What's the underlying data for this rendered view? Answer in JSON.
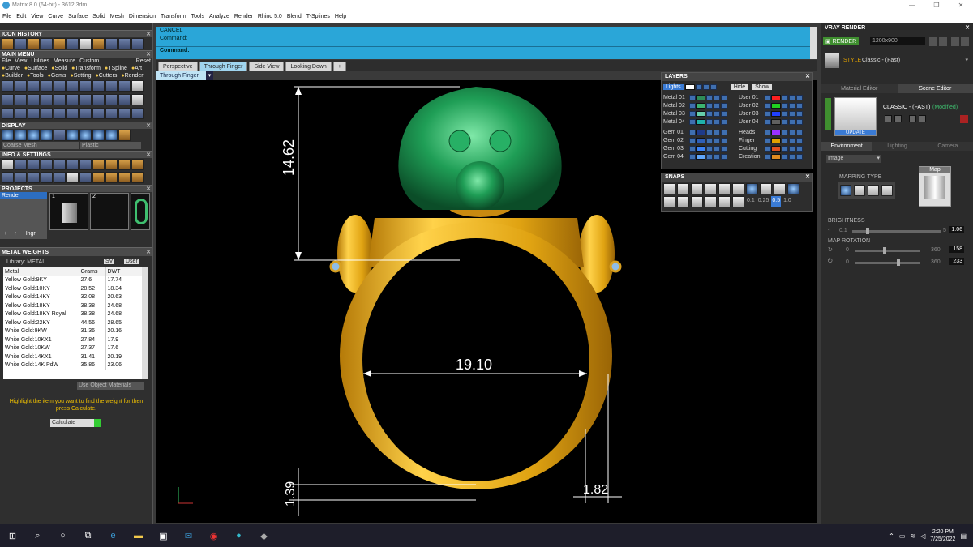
{
  "window": {
    "title": "Matrix 8.0 (64-bit) - 3612.3dm"
  },
  "menu": [
    "File",
    "Edit",
    "View",
    "Curve",
    "Surface",
    "Solid",
    "Mesh",
    "Dimension",
    "Transform",
    "Tools",
    "Analyze",
    "Render",
    "Rhino 5.0",
    "Blend",
    "T-Splines",
    "Help"
  ],
  "left": {
    "icon_history": "ICON HISTORY",
    "main_menu": "MAIN MENU",
    "main_menu_row1": [
      "File",
      "View",
      "Utilities",
      "Measure",
      "Custom",
      "Reset"
    ],
    "main_menu_row2": [
      "Curve",
      "Surface",
      "Solid",
      "Transform",
      "TSpline",
      "Art"
    ],
    "main_menu_row3": [
      "Builder",
      "Tools",
      "Gems",
      "Setting",
      "Cutters",
      "Render"
    ],
    "display": "DISPLAY",
    "display_mode": "Coarse Mesh",
    "display_material": "Plastic",
    "info_settings": "INFO & SETTINGS",
    "projects": "PROJECTS",
    "project_item": "Render",
    "thumb1": "1",
    "thumb2": "2",
    "hngr_button": "Hngr",
    "metal_weights_title": "METAL WEIGHTS",
    "library_label": "Library: METAL",
    "sv_label": "SV",
    "user_label": "User",
    "columns": [
      "Metal",
      "Grams",
      "DWT"
    ],
    "rows": [
      [
        "Yellow Gold:9KY",
        "27.6",
        "17.74"
      ],
      [
        "Yellow Gold:10KY",
        "28.52",
        "18.34"
      ],
      [
        "Yellow Gold:14KY",
        "32.08",
        "20.63"
      ],
      [
        "Yellow Gold:18KY",
        "38.38",
        "24.68"
      ],
      [
        "Yellow Gold:18KY Royal",
        "38.38",
        "24.68"
      ],
      [
        "Yellow Gold:22KY",
        "44.56",
        "28.65"
      ],
      [
        "White Gold:9KW",
        "31.36",
        "20.16"
      ],
      [
        "White Gold:10KX1",
        "27.84",
        "17.9"
      ],
      [
        "White Gold:10KW",
        "27.37",
        "17.6"
      ],
      [
        "White Gold:14KX1",
        "31.41",
        "20.19"
      ],
      [
        "White Gold:14K PdW",
        "35.86",
        "23.06"
      ]
    ],
    "use_object_materials": "Use Object Materials",
    "hint": "Highlight the item you want to find the weight for then press Calculate.",
    "calculate": "Calculate"
  },
  "command": {
    "line1": "CANCEL",
    "line2": "Command:",
    "line3": "Command:"
  },
  "tabs": [
    "Perspective",
    "Through Finger",
    "Side View",
    "Looking Down",
    "+"
  ],
  "viewport_select": "Through Finger",
  "dimensions": {
    "height": "14.62",
    "inner_diameter": "19.10",
    "thickness": "1.39",
    "shank": "1.82"
  },
  "layers": {
    "title": "LAYERS",
    "lights": "Lights",
    "hide": "Hide",
    "show": "Show",
    "left": [
      {
        "name": "Metal 01",
        "color": "#2e8b57"
      },
      {
        "name": "Metal 02",
        "color": "#3cb371"
      },
      {
        "name": "Metal 03",
        "color": "#66cdaa"
      },
      {
        "name": "Metal 04",
        "color": "#20b2aa"
      },
      {
        "name": "Gem 01",
        "color": "#1e3a8a"
      },
      {
        "name": "Gem 02",
        "color": "#2f5fb8"
      },
      {
        "name": "Gem 03",
        "color": "#3b82f6"
      },
      {
        "name": "Gem 04",
        "color": "#60a5fa"
      }
    ],
    "right": [
      {
        "name": "User 01",
        "color": "#ff2020"
      },
      {
        "name": "User 02",
        "color": "#20d020"
      },
      {
        "name": "User 03",
        "color": "#2040ff"
      },
      {
        "name": "User 04",
        "color": "#606060"
      },
      {
        "name": "Heads",
        "color": "#9b30ff"
      },
      {
        "name": "Finger",
        "color": "#e0a000"
      },
      {
        "name": "Cutting",
        "color": "#e05020"
      },
      {
        "name": "Creation",
        "color": "#e08a20"
      }
    ]
  },
  "snaps": {
    "title": "SNAPS",
    "values": [
      "0.1",
      "0.25",
      "0.5",
      "1.0"
    ]
  },
  "vray": {
    "title": "VRAY RENDER",
    "render_button": "RENDER",
    "resolution": "1200x900",
    "style_label": "STYLE",
    "style_value": "Classic - (Fast)",
    "tab_material": "Material Editor",
    "tab_scene": "Scene Editor",
    "preset_name": "CLASSIC - (FAST)",
    "modified": "(Modified)",
    "update": "UPDATE",
    "env_tabs": [
      "Environment",
      "Lighting",
      "Camera"
    ],
    "env_type": "Image",
    "mapping_type": "MAPPING TYPE",
    "map_label": "Map",
    "brightness_label": "BRIGHTNESS",
    "brightness_min": "0.1",
    "brightness_max": "5",
    "brightness_value": "1.06",
    "map_rotation_label": "MAP ROTATION",
    "rot1_min": "0",
    "rot1_max": "360",
    "rot1_value": "158",
    "rot2_min": "0",
    "rot2_max": "360",
    "rot2_value": "233"
  },
  "taskbar": {
    "time": "2:20 PM",
    "date": "7/25/2022"
  }
}
